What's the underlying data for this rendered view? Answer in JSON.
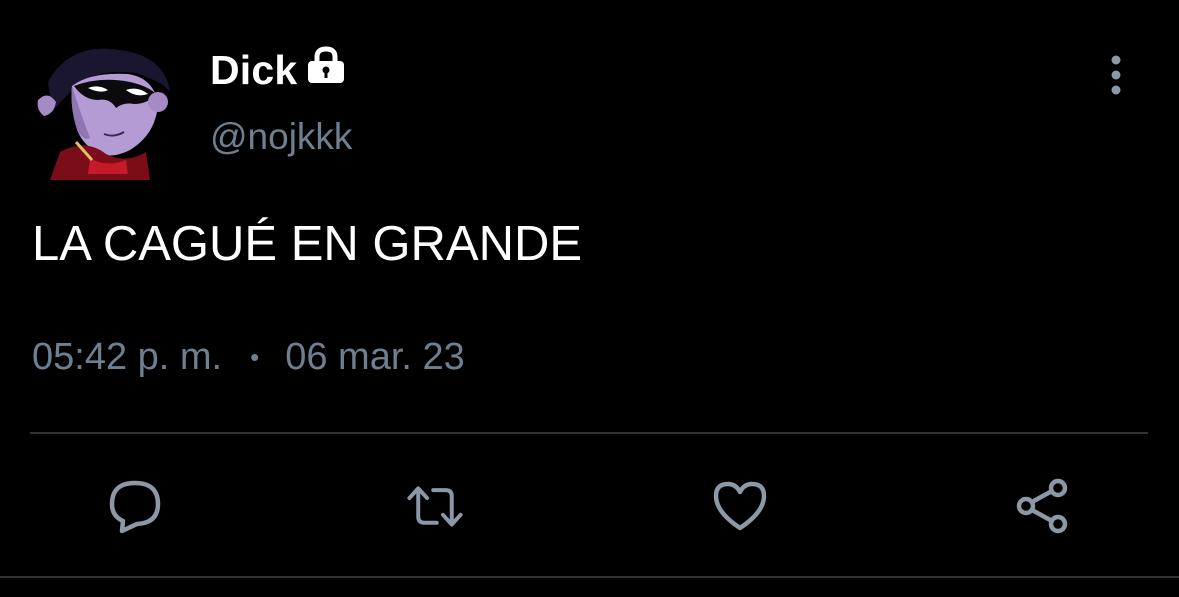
{
  "tweet": {
    "display_name": "Dick",
    "handle": "@nojkkk",
    "text": "LA CAGUÉ EN GRANDE",
    "time": "05:42 p. m.",
    "separator": "•",
    "date": "06 mar. 23",
    "protected": true
  },
  "icons": {
    "lock": "lock-icon",
    "more": "vertical-dots-icon",
    "reply": "speech-bubble-icon",
    "retweet": "retweet-arrows-icon",
    "like": "heart-icon",
    "share": "share-nodes-icon"
  },
  "colors": {
    "background": "#000000",
    "primary_text": "#ffffff",
    "secondary_text": "#6e7f8f",
    "divider": "#2f3336"
  }
}
